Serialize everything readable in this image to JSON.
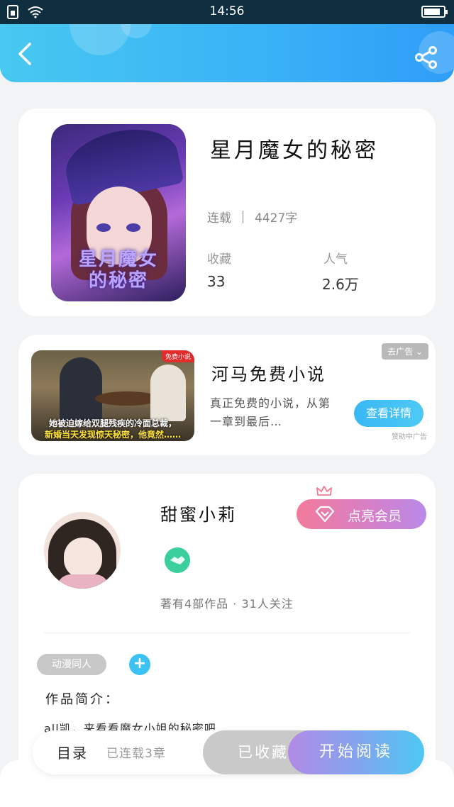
{
  "status_bar": {
    "time": "14:56"
  },
  "book": {
    "title": "星月魔女的秘密",
    "status": "连载",
    "word_count": "4427字",
    "favorites_label": "收藏",
    "favorites_value": "33",
    "popularity_label": "人气",
    "popularity_value": "2.6万",
    "cover_text_line1": "星月魔女",
    "cover_text_line2": "的秘密"
  },
  "ad": {
    "title": "河马免费小说",
    "description": "真正免费的小说，从第一章到最后…",
    "close_label": "去广告",
    "cta_label": "查看详情",
    "source": "赞助中广告",
    "image_badge": "免费小说",
    "image_caption_line1": "她被迫嫁给双腿残疾的冷面总裁，",
    "image_caption_line2": "新婚当天发现惊天秘密，他竟然……"
  },
  "author": {
    "name": "甜蜜小莉",
    "vip_button": "点亮会员",
    "stats": "著有4部作品 · 31人关注",
    "tag": "动漫同人",
    "tag_add": "+",
    "intro_label": "作品简介：",
    "intro_text": "all凯，来看看魔女小姐的秘密吧"
  },
  "bottom_bar": {
    "catalog_label": "目录",
    "chapters_text": "已连载3章",
    "favorite_button": "已收藏",
    "read_button": "开始阅读"
  },
  "colors": {
    "header_start": "#48c8f0",
    "header_end": "#2f9ef7",
    "accent_blue": "#3bb8f5",
    "vip_pink": "#f27b9a",
    "vip_purple": "#b989e8",
    "badge_green": "#3bcf9e"
  },
  "icons": [
    "sim-icon",
    "wifi-icon",
    "battery-icon",
    "back-icon",
    "share-icon",
    "crown-icon",
    "diamond-icon",
    "handshake-badge-icon",
    "chevron-down-icon"
  ]
}
